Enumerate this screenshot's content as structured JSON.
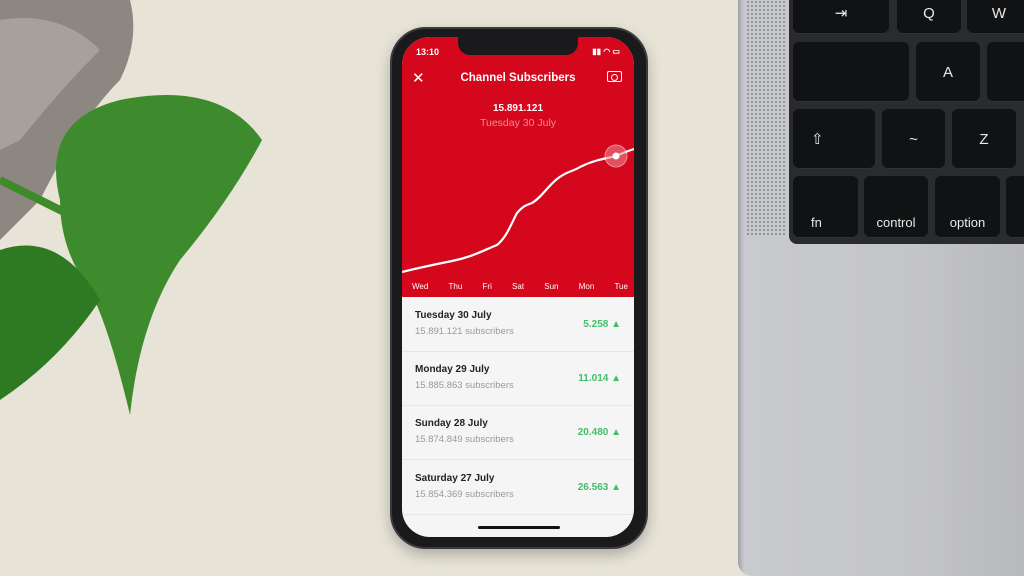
{
  "status_bar": {
    "time": "13:10"
  },
  "header": {
    "title": "Channel Subscribers",
    "close_icon": "close-icon",
    "camera_icon": "camera-icon"
  },
  "highlight": {
    "value": "15.891.121",
    "date": "Tuesday 30 July"
  },
  "chart_data": {
    "type": "line",
    "categories": [
      "Wed",
      "Thu",
      "Fri",
      "Sat",
      "Sun",
      "Mon",
      "Tue"
    ],
    "highlight_index": 6,
    "line_color": "#ffffff",
    "background": "#d4071c"
  },
  "list": [
    {
      "date": "Tuesday 30 July",
      "subscribers": "15.891.121 subscribers",
      "delta": "5.258 ▲"
    },
    {
      "date": "Monday 29 July",
      "subscribers": "15.885.863 subscribers",
      "delta": "11.014 ▲"
    },
    {
      "date": "Sunday 28 July",
      "subscribers": "15.874.849 subscribers",
      "delta": "20.480 ▲"
    },
    {
      "date": "Saturday 27 July",
      "subscribers": "15.854.369 subscribers",
      "delta": "26.563 ▲"
    }
  ],
  "keyboard": {
    "keys": [
      "⇥",
      "Q",
      "W",
      "A",
      "⇧",
      "~",
      "Z",
      "fn",
      "control",
      "option"
    ]
  },
  "colors": {
    "accent": "#d4071c",
    "positive": "#3fbf6a"
  }
}
